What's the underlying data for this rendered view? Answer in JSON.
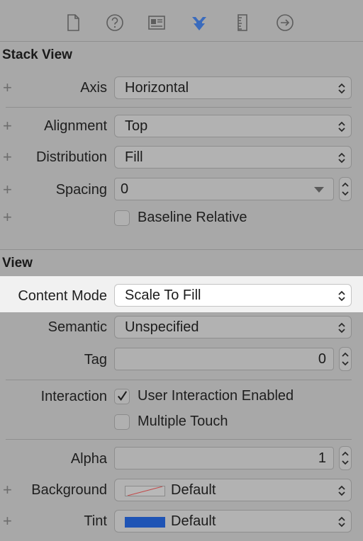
{
  "tabs": [
    {
      "icon": "file-icon"
    },
    {
      "icon": "help-icon"
    },
    {
      "icon": "identity-icon"
    },
    {
      "icon": "attributes-icon"
    },
    {
      "icon": "size-ruler-icon"
    },
    {
      "icon": "connections-arrow-icon"
    }
  ],
  "stack_view": {
    "title": "Stack View",
    "axis": {
      "label": "Axis",
      "value": "Horizontal"
    },
    "alignment": {
      "label": "Alignment",
      "value": "Top"
    },
    "distribution": {
      "label": "Distribution",
      "value": "Fill"
    },
    "spacing": {
      "label": "Spacing",
      "value": "0"
    },
    "baseline_relative": {
      "label": "Baseline Relative",
      "checked": false
    }
  },
  "view": {
    "title": "View",
    "content_mode": {
      "label": "Content Mode",
      "value": "Scale To Fill"
    },
    "semantic": {
      "label": "Semantic",
      "value": "Unspecified"
    },
    "tag": {
      "label": "Tag",
      "value": "0"
    },
    "interaction": {
      "label": "Interaction",
      "user_interaction": {
        "label": "User Interaction Enabled",
        "checked": true
      },
      "multiple_touch": {
        "label": "Multiple Touch",
        "checked": false
      }
    },
    "alpha": {
      "label": "Alpha",
      "value": "1"
    },
    "background": {
      "label": "Background",
      "value": "Default"
    },
    "tint": {
      "label": "Tint",
      "value": "Default",
      "color": "#1f54b5"
    }
  },
  "colors": {
    "accent": "#3a6bbd",
    "panel": "#a8a8a8",
    "highlight": "#f1f1f1"
  }
}
